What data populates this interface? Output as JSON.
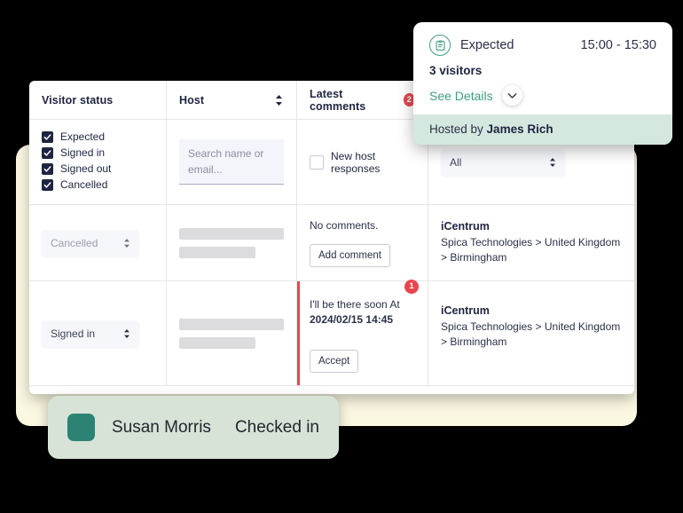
{
  "table": {
    "columns": [
      {
        "label": "Visitor status",
        "sort": false,
        "badge": null
      },
      {
        "label": "Host",
        "sort": true,
        "badge": null
      },
      {
        "label": "Latest comments",
        "sort": false,
        "badge": "2"
      },
      {
        "label": "",
        "sort": false,
        "badge": null
      }
    ],
    "filters": {
      "status_checkboxes": [
        {
          "label": "Expected",
          "checked": true
        },
        {
          "label": "Signed in",
          "checked": true
        },
        {
          "label": "Signed out",
          "checked": true
        },
        {
          "label": "Cancelled",
          "checked": true
        }
      ],
      "host_search_placeholder": "Search name or email...",
      "host_search_value": "",
      "comments_checkbox": {
        "label": "New host responses",
        "checked": false
      },
      "location_select_value": "All"
    },
    "rows": [
      {
        "status_value": "Cancelled",
        "comment_text": "No comments.",
        "comment_button": "Add comment",
        "comment_badge": null,
        "flagged": false,
        "location_name": "iCentrum",
        "location_path": "Spica Technologies > United Kingdom > Birmingham"
      },
      {
        "status_value": "Signed in",
        "comment_text": "I'll be there soon At",
        "comment_time": "2024/02/15 14:45",
        "comment_button": "Accept",
        "comment_badge": "1",
        "flagged": true,
        "location_name": "iCentrum",
        "location_path": "Spica Technologies > United Kingdom > Birmingham"
      }
    ]
  },
  "popup": {
    "status": "Expected",
    "time_range": "15:00 - 15:30",
    "visitors": "3 visitors",
    "details_link": "See Details",
    "hosted_prefix": "Hosted by ",
    "host_name": "James Rich"
  },
  "toast": {
    "visitor_name": "Susan Morris",
    "status": "Checked in"
  },
  "colors": {
    "accent_green": "#3F9D84",
    "toast_green": "#D7E3D6",
    "toast_square": "#2C8374",
    "badge_red": "#E8464F",
    "yellow_card": "#FBF8E2",
    "dark_navy": "#1e2440",
    "popup_footer": "#D5E8DF"
  }
}
